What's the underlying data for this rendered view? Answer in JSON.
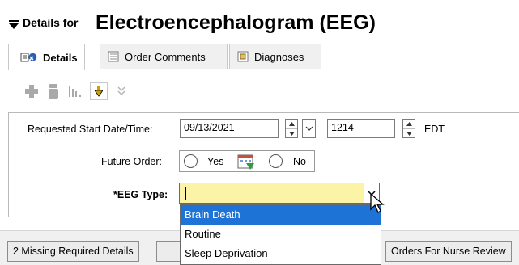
{
  "header": {
    "prefix": "Details for",
    "title": "Electroencephalogram (EEG)"
  },
  "tabs": [
    {
      "label": "Details",
      "active": true
    },
    {
      "label": "Order Comments",
      "active": false
    },
    {
      "label": "Diagnoses",
      "active": false
    }
  ],
  "form": {
    "start_label": "Requested Start Date/Time:",
    "start_date": "09/13/2021",
    "start_time": "1214",
    "timezone": "EDT",
    "future_label": "Future Order:",
    "future_yes": "Yes",
    "future_no": "No",
    "eeg_label": "*EEG Type:",
    "eeg_value": "",
    "eeg_options": [
      "Brain Death",
      "Routine",
      "Sleep Deprivation"
    ]
  },
  "status": {
    "missing": "2 Missing Required Details",
    "nurse_review": "Orders For Nurse Review"
  },
  "colors": {
    "selection": "#1e73d6",
    "required_field": "#fbf3a6"
  }
}
